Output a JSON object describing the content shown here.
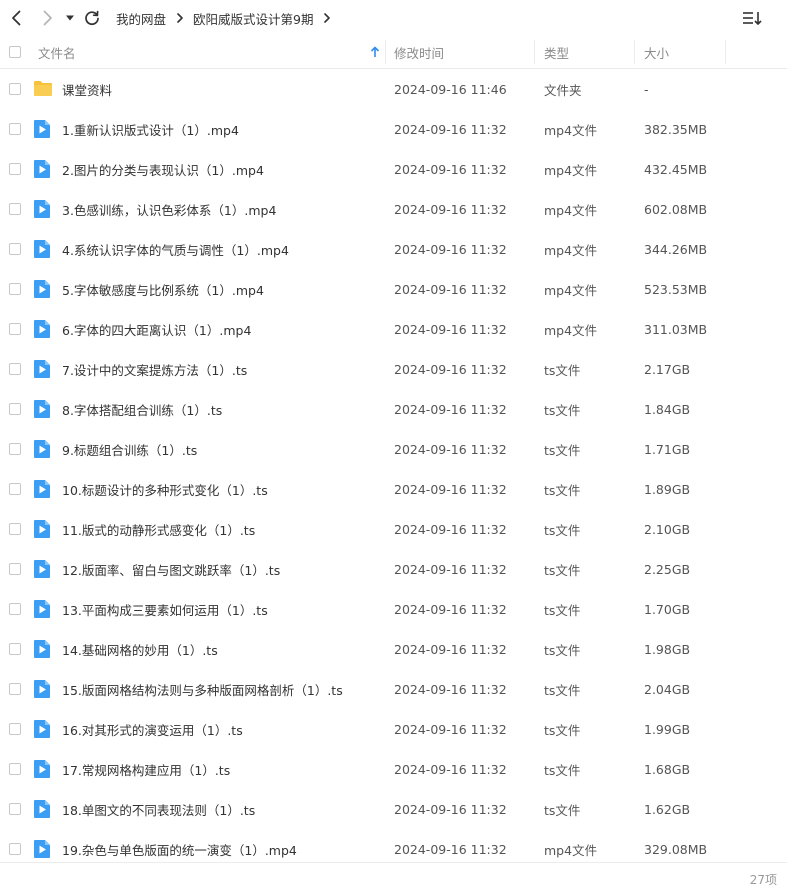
{
  "nav": {
    "back_icon": "chevron-left-icon",
    "forward_icon": "chevron-right-icon",
    "dropdown_icon": "triangle-down-icon",
    "refresh_icon": "refresh-icon",
    "sort_icon": "sort-list-icon"
  },
  "breadcrumb": {
    "items": [
      "我的网盘",
      "欧阳威版式设计第9期"
    ]
  },
  "columns": {
    "name": "文件名",
    "modified": "修改时间",
    "type": "类型",
    "size": "大小",
    "sort_indicator": "arrow-up-icon"
  },
  "colors": {
    "accent": "#2f8cf0",
    "folder": "#f7c23a",
    "video_icon": "#3b9df3"
  },
  "files": [
    {
      "name": "课堂资料",
      "time": "2024-09-16 11:46",
      "type": "文件夹",
      "size": "-",
      "kind": "folder"
    },
    {
      "name": "1.重新认识版式设计（1）.mp4",
      "time": "2024-09-16 11:32",
      "type": "mp4文件",
      "size": "382.35MB",
      "kind": "video"
    },
    {
      "name": "2.图片的分类与表现认识（1）.mp4",
      "time": "2024-09-16 11:32",
      "type": "mp4文件",
      "size": "432.45MB",
      "kind": "video"
    },
    {
      "name": "3.色感训练，认识色彩体系（1）.mp4",
      "time": "2024-09-16 11:32",
      "type": "mp4文件",
      "size": "602.08MB",
      "kind": "video"
    },
    {
      "name": "4.系统认识字体的气质与调性（1）.mp4",
      "time": "2024-09-16 11:32",
      "type": "mp4文件",
      "size": "344.26MB",
      "kind": "video"
    },
    {
      "name": "5.字体敏感度与比例系统（1）.mp4",
      "time": "2024-09-16 11:32",
      "type": "mp4文件",
      "size": "523.53MB",
      "kind": "video"
    },
    {
      "name": "6.字体的四大距离认识（1）.mp4",
      "time": "2024-09-16 11:32",
      "type": "mp4文件",
      "size": "311.03MB",
      "kind": "video"
    },
    {
      "name": "7.设计中的文案提炼方法（1）.ts",
      "time": "2024-09-16 11:32",
      "type": "ts文件",
      "size": "2.17GB",
      "kind": "video"
    },
    {
      "name": "8.字体搭配组合训练（1）.ts",
      "time": "2024-09-16 11:32",
      "type": "ts文件",
      "size": "1.84GB",
      "kind": "video"
    },
    {
      "name": "9.标题组合训练（1）.ts",
      "time": "2024-09-16 11:32",
      "type": "ts文件",
      "size": "1.71GB",
      "kind": "video"
    },
    {
      "name": "10.标题设计的多种形式变化（1）.ts",
      "time": "2024-09-16 11:32",
      "type": "ts文件",
      "size": "1.89GB",
      "kind": "video"
    },
    {
      "name": "11.版式的动静形式感变化（1）.ts",
      "time": "2024-09-16 11:32",
      "type": "ts文件",
      "size": "2.10GB",
      "kind": "video"
    },
    {
      "name": "12.版面率、留白与图文跳跃率（1）.ts",
      "time": "2024-09-16 11:32",
      "type": "ts文件",
      "size": "2.25GB",
      "kind": "video"
    },
    {
      "name": "13.平面构成三要素如何运用（1）.ts",
      "time": "2024-09-16 11:32",
      "type": "ts文件",
      "size": "1.70GB",
      "kind": "video"
    },
    {
      "name": "14.基础网格的妙用（1）.ts",
      "time": "2024-09-16 11:32",
      "type": "ts文件",
      "size": "1.98GB",
      "kind": "video"
    },
    {
      "name": "15.版面网格结构法则与多种版面网格剖析（1）.ts",
      "time": "2024-09-16 11:32",
      "type": "ts文件",
      "size": "2.04GB",
      "kind": "video"
    },
    {
      "name": "16.对其形式的演变运用（1）.ts",
      "time": "2024-09-16 11:32",
      "type": "ts文件",
      "size": "1.99GB",
      "kind": "video"
    },
    {
      "name": "17.常规网格构建应用（1）.ts",
      "time": "2024-09-16 11:32",
      "type": "ts文件",
      "size": "1.68GB",
      "kind": "video"
    },
    {
      "name": "18.单图文的不同表现法则（1）.ts",
      "time": "2024-09-16 11:32",
      "type": "ts文件",
      "size": "1.62GB",
      "kind": "video"
    },
    {
      "name": "19.杂色与单色版面的统一演变（1）.mp4",
      "time": "2024-09-16 11:32",
      "type": "mp4文件",
      "size": "329.08MB",
      "kind": "video"
    }
  ],
  "footer": {
    "count": "27项"
  }
}
